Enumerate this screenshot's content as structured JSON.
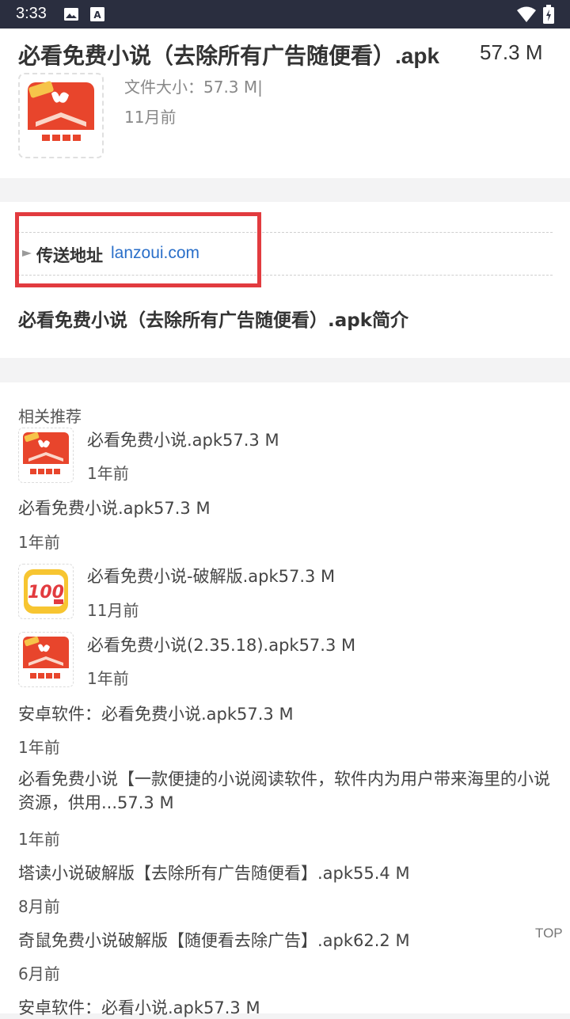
{
  "status_bar": {
    "time": "3:33"
  },
  "app": {
    "title": "必看免费小说（去除所有广告随便看）.apk",
    "size": "57.3 M",
    "file_size_text": "文件大小：57.3 M|",
    "date": "11月前"
  },
  "transfer": {
    "label": "传送地址",
    "url": "lanzoui.com"
  },
  "intro_title": "必看免费小说（去除所有广告随便看）.apk简介",
  "recommend": {
    "heading": "相关推荐",
    "items": [
      {
        "title": "必看免费小说.apk57.3 M",
        "date": "1年前",
        "icon": "bikan-novel-icon"
      },
      {
        "title": "必看免费小说.apk57.3 M",
        "date": "1年前"
      },
      {
        "title": "必看免费小说-破解版.apk57.3 M",
        "date": "11月前",
        "icon": "100-app-icon"
      },
      {
        "title": "必看免费小说(2.35.18).apk57.3 M",
        "date": "1年前",
        "icon": "bikan-novel-icon"
      },
      {
        "title": "安卓软件：必看免费小说.apk57.3 M",
        "date": "1年前"
      },
      {
        "title": "必看免费小说【一款便捷的小说阅读软件，软件内为用户带来海里的小说资源，供用...57.3 M",
        "date": "1年前"
      },
      {
        "title": "塔读小说破解版【去除所有广告随便看】.apk55.4 M",
        "date": "8月前"
      },
      {
        "title": "奇鼠免费小说破解版【随便看去除广告】.apk62.2 M",
        "date": "6月前"
      },
      {
        "title": "安卓软件：必看小说.apk57.3 M",
        "date": ""
      }
    ]
  },
  "top_button": "TOP",
  "colors": {
    "status_bar": "#2a2e3f",
    "highlight": "#e23b3f",
    "link": "#2a6fc9"
  }
}
